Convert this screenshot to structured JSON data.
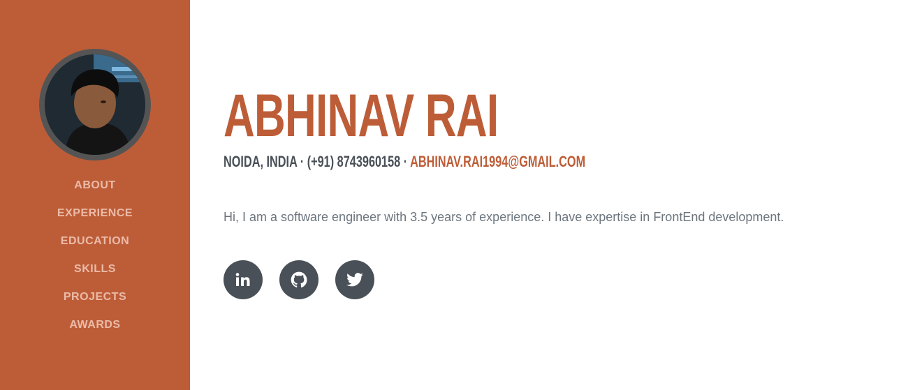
{
  "sidebar": {
    "avatar_alt": "profile photo",
    "nav": [
      {
        "label": "About"
      },
      {
        "label": "Experience"
      },
      {
        "label": "Education"
      },
      {
        "label": "Skills"
      },
      {
        "label": "Projects"
      },
      {
        "label": "Awards"
      }
    ]
  },
  "main": {
    "name": "Abhinav Rai",
    "location": "Noida, India",
    "separator": " · ",
    "phone": "(+91) 8743960158",
    "email": "abhinav.rai1994@gmail.com",
    "intro": "Hi, I am a software engineer with 3.5 years of experience. I have expertise in FrontEnd development.",
    "social": [
      {
        "icon": "linkedin-icon"
      },
      {
        "icon": "github-icon"
      },
      {
        "icon": "twitter-icon"
      }
    ]
  },
  "colors": {
    "primary": "#bd5d38",
    "nav_text": "#ebbba8",
    "dark": "#495057",
    "muted": "#6c757d",
    "background": "#ffffff"
  }
}
